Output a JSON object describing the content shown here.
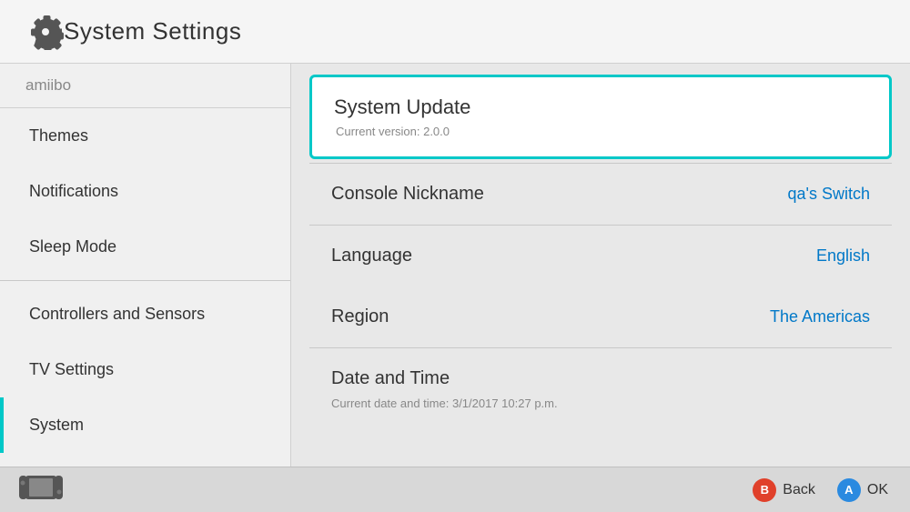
{
  "header": {
    "title": "System Settings",
    "icon": "gear-icon"
  },
  "sidebar": {
    "top_item": "amiibo",
    "items": [
      {
        "id": "themes",
        "label": "Themes",
        "active": false
      },
      {
        "id": "notifications",
        "label": "Notifications",
        "active": false
      },
      {
        "id": "sleep-mode",
        "label": "Sleep Mode",
        "active": false
      },
      {
        "id": "controllers",
        "label": "Controllers and Sensors",
        "active": false
      },
      {
        "id": "tv-settings",
        "label": "TV Settings",
        "active": false
      },
      {
        "id": "system",
        "label": "System",
        "active": true
      }
    ]
  },
  "content": {
    "system_update": {
      "title": "System Update",
      "subtitle": "Current version: 2.0.0"
    },
    "rows": [
      {
        "id": "console-nickname",
        "label": "Console Nickname",
        "value": "qa's Switch"
      },
      {
        "id": "language",
        "label": "Language",
        "value": "English"
      },
      {
        "id": "region",
        "label": "Region",
        "value": "The Americas"
      },
      {
        "id": "date-time",
        "label": "Date and Time",
        "value": ""
      }
    ],
    "date_time_sub": "Current date and time: 3/1/2017 10:27 p.m."
  },
  "footer": {
    "switch_label": "switch-console",
    "back_label": "Back",
    "ok_label": "OK",
    "b_btn": "B",
    "a_btn": "A"
  }
}
